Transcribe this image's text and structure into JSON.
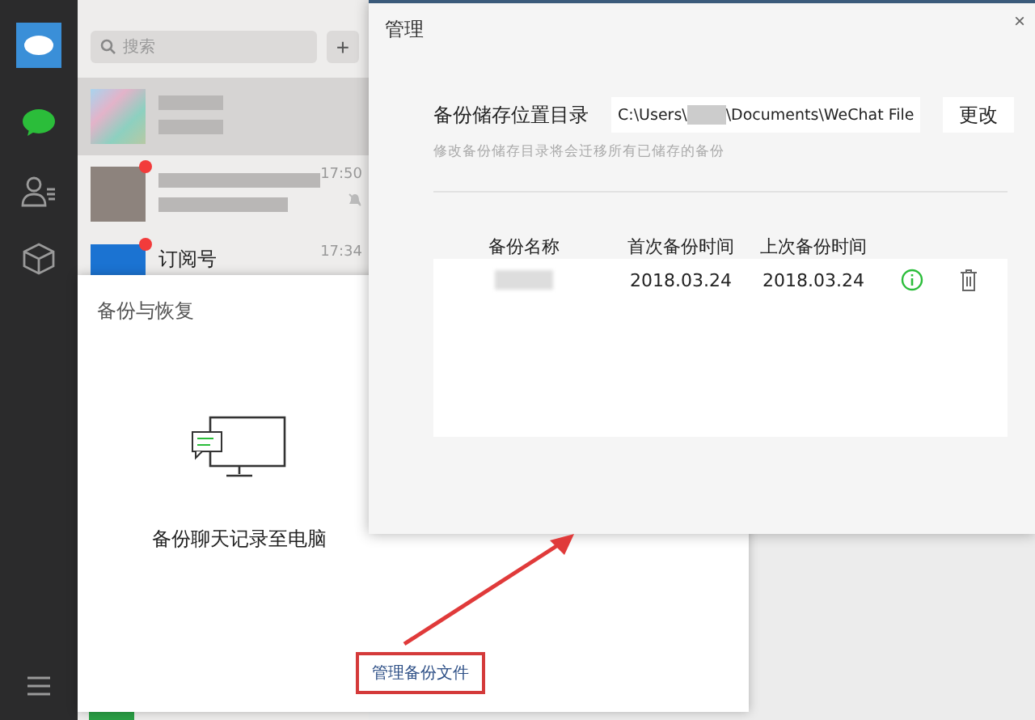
{
  "sidebar": {
    "items": [
      {
        "kind": "chats",
        "selected": true
      },
      {
        "kind": "contacts",
        "selected": false
      },
      {
        "kind": "apps",
        "selected": false
      }
    ]
  },
  "chat_list": {
    "search": {
      "placeholder": "搜索"
    },
    "add_button": "+",
    "conversations": [
      {
        "kind": "group",
        "selected": true,
        "unread": false,
        "muted": false
      },
      {
        "kind": "person",
        "selected": false,
        "unread": true,
        "muted": true,
        "time": "17:50"
      },
      {
        "kind": "subscription",
        "selected": false,
        "unread": true,
        "muted": false,
        "name": "订阅号",
        "time": "17:34"
      }
    ]
  },
  "backup_dialog": {
    "title": "备份与恢复",
    "option_label": "备份聊天记录至电脑",
    "manage_link": "管理备份文件"
  },
  "manage_dialog": {
    "title": "管理",
    "close": "×",
    "location_label": "备份储存位置目录",
    "path": {
      "prefix": "C:\\Users\\",
      "suffix": "\\Documents\\WeChat File"
    },
    "change_button": "更改",
    "hint": "修改备份储存目录将会迁移所有已储存的备份",
    "table": {
      "columns": [
        "备份名称",
        "首次备份时间",
        "上次备份时间"
      ],
      "rows": [
        {
          "first_backup": "2018.03.24",
          "last_backup": "2018.03.24"
        }
      ]
    }
  }
}
